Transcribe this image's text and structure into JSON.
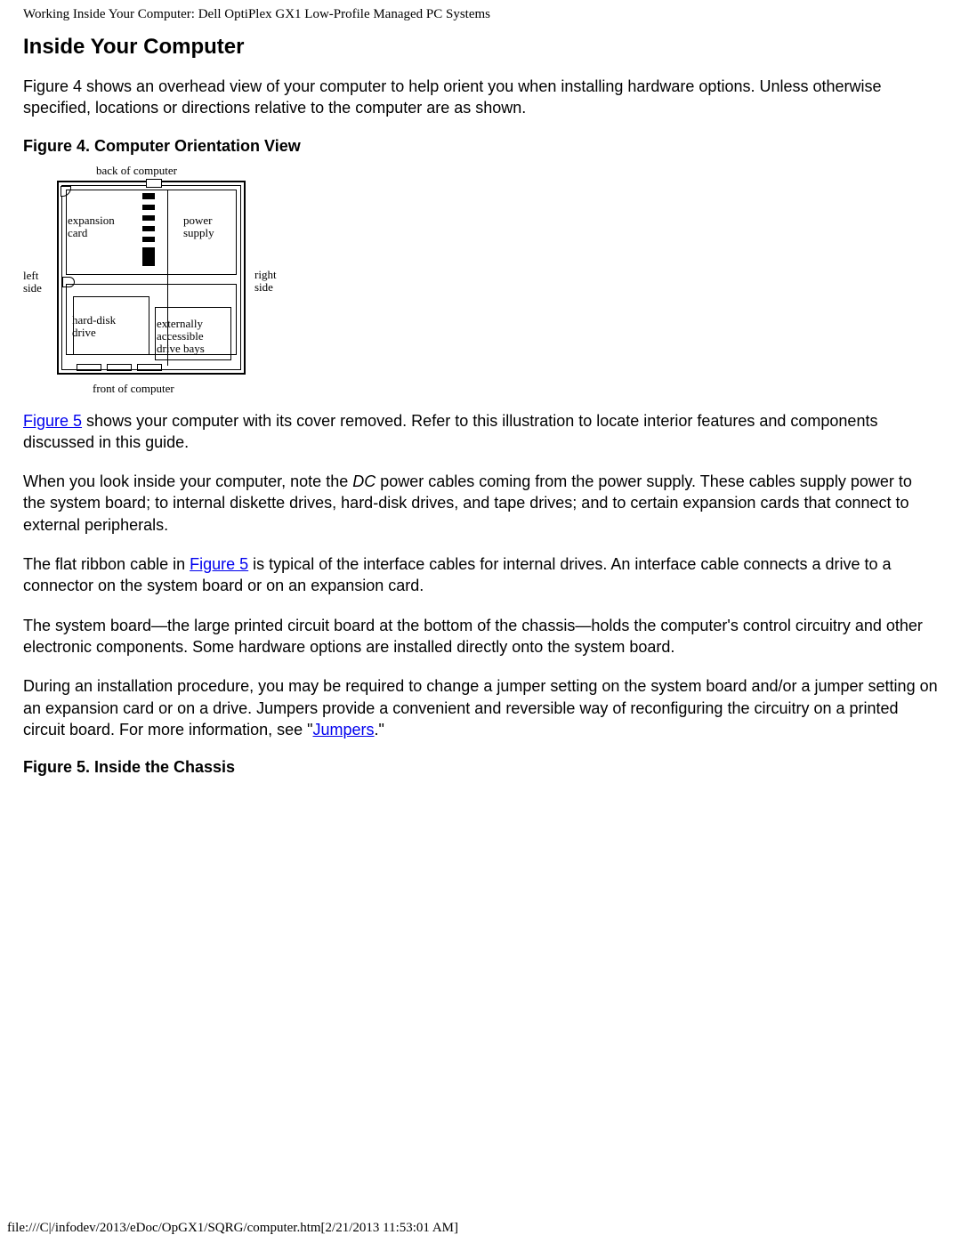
{
  "header": {
    "title": "Working Inside Your Computer: Dell OptiPlex GX1 Low-Profile Managed PC Systems"
  },
  "section": {
    "heading": "Inside Your Computer",
    "para1": "Figure 4 shows an overhead view of your computer to help orient you when installing hardware options. Unless otherwise specified, locations or directions relative to the computer are as shown.",
    "fig4_caption": "Figure 4. Computer Orientation View",
    "fig4_labels": {
      "top": "back of computer",
      "left": "left\nside",
      "right": "right\nside",
      "bottom": "front of computer",
      "expansion": "expansion\ncard",
      "power": "power\nsupply",
      "hdd": "hard-disk\ndrive",
      "ext": "externally\naccessible\ndrive bays"
    },
    "para2_link": "Figure 5",
    "para2_rest": " shows your computer with its cover removed. Refer to this illustration to locate interior features and components discussed in this guide.",
    "para3_a": "When you look inside your computer, note the ",
    "para3_dc": "DC",
    "para3_b": " power cables coming from the power supply. These cables supply power to the system board; to internal diskette drives, hard-disk drives, and tape drives; and to certain expansion cards that connect to external peripherals.",
    "para4_a": "The flat ribbon cable in ",
    "para4_link": "Figure 5",
    "para4_b": " is typical of the interface cables for internal drives. An interface cable connects a drive to a connector on the system board or on an expansion card.",
    "para5": "The system board—the large printed circuit board at the bottom of the chassis—holds the computer's control circuitry and other electronic components. Some hardware options are installed directly onto the system board.",
    "para6_a": "During an installation procedure, you may be required to change a jumper setting on the system board and/or a jumper setting on an expansion card or on a drive. Jumpers provide a convenient and reversible way of reconfiguring the circuitry on a printed circuit board. For more information, see \"",
    "para6_link": "Jumpers",
    "para6_b": ".\"",
    "fig5_caption": "Figure 5. Inside the Chassis"
  },
  "footer": {
    "path": "file:///C|/infodev/2013/eDoc/OpGX1/SQRG/computer.htm[2/21/2013 11:53:01 AM]"
  }
}
